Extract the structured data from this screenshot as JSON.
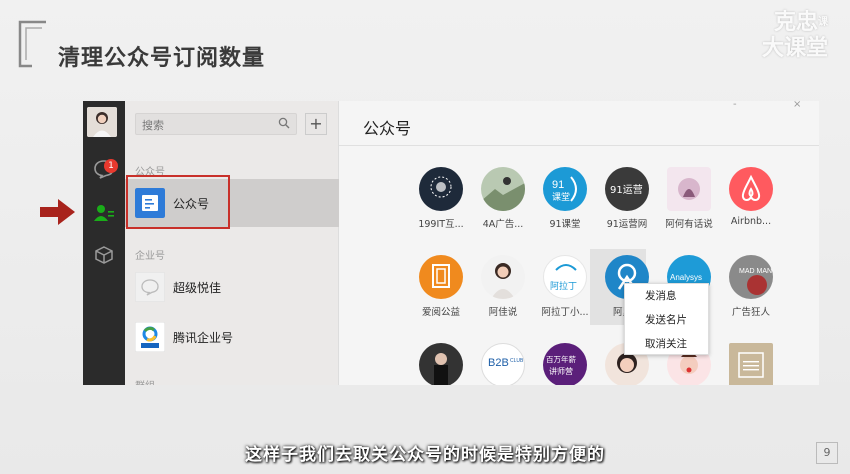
{
  "slide": {
    "title": "清理公众号订阅数量",
    "brand_line1": "克忠",
    "brand_mark": "课",
    "brand_line2": "大课堂",
    "subtitle": "这样子我们去取关公众号的时候是特别方便的",
    "page_number": "9"
  },
  "nav": {
    "unread_badge": "1"
  },
  "list": {
    "search_placeholder": "搜索",
    "add_label": "+",
    "section_official": "公众号",
    "official_item": "公众号",
    "section_enterprise": "企业号",
    "enterprise_items": [
      "超级悦佳",
      "腾讯企业号"
    ],
    "section_bottom": "群组"
  },
  "content": {
    "title": "公众号",
    "win_min": "-",
    "win_close": "×",
    "rows": [
      [
        "199IT互...",
        "4A广告...",
        "91课堂",
        "91运营网",
        "阿何有话说",
        "Airbnb..."
      ],
      [
        "爱阅公益",
        "阿佳说",
        "阿拉丁小...",
        "阿里...",
        "",
        "广告狂人"
      ],
      [
        "",
        "",
        "",
        "",
        "",
        ""
      ]
    ],
    "tile_texts": {
      "t91a": "91",
      "t91b": "课堂",
      "t91yy": "91运营",
      "aladin": "阿拉丁",
      "analysys": "Analysys",
      "madman": "MAD MAN",
      "b2b": "B2B",
      "b2b_club": "CLUB",
      "bwn1": "百万年薪",
      "bwn2": "讲师营"
    }
  },
  "context_menu": {
    "items": [
      "发消息",
      "发送名片",
      "取消关注"
    ]
  },
  "colors": {
    "accent_red": "#c8302a",
    "wechat_green": "#1aad19",
    "airbnb": "#ff5a5f"
  }
}
